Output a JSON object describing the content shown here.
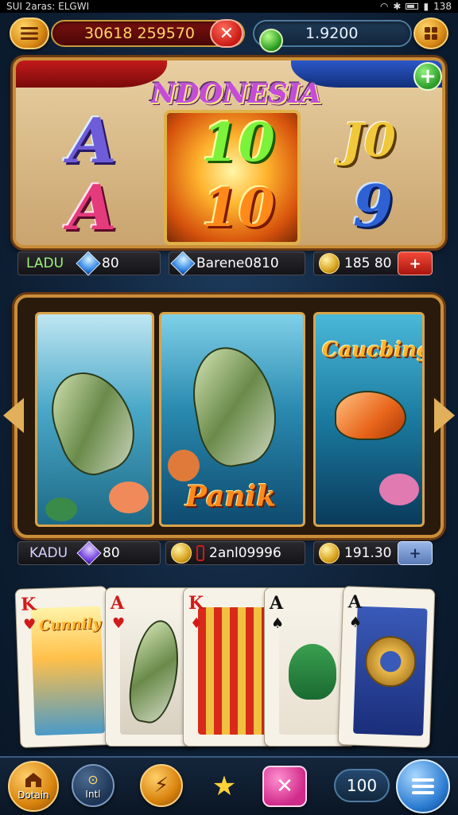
{
  "status_bar": {
    "left_text": "SUI 2aras: ELGWI",
    "right_text": "138"
  },
  "top_bar": {
    "balance_red": "30618 259570",
    "balance_blue": "1.9200"
  },
  "top_panel": {
    "title": "NDONESIA",
    "symbols": {
      "left_top": "A",
      "left_bottom": "A",
      "center_top": "10",
      "center_bottom": "10",
      "right_top": "J0",
      "right_bottom": "9"
    }
  },
  "stats_row_1": {
    "label": "LADU",
    "gem_value": "80",
    "name": "Barene0810",
    "coins": "185 80",
    "button": "+"
  },
  "middle_panel": {
    "word_center": "Panik",
    "word_right": "Caucbing"
  },
  "stats_row_2": {
    "label": "KADU",
    "gem_value": "80",
    "name": "2anl09996",
    "coins": "191.30",
    "button": "+"
  },
  "cards": [
    {
      "rank": "K",
      "suit": "♥",
      "color": "red",
      "art_text": "Cunnily"
    },
    {
      "rank": "A",
      "suit": "♥",
      "color": "red",
      "art_text": ""
    },
    {
      "rank": "K",
      "suit": "♦",
      "color": "red",
      "art_text": ""
    },
    {
      "rank": "A",
      "suit": "♠",
      "color": "black",
      "art_text": ""
    },
    {
      "rank": "A",
      "suit": "♠",
      "color": "black",
      "art_text": ""
    }
  ],
  "bottom_bar": {
    "home_label": "Dotain",
    "info_label": "Intl",
    "count": "100"
  },
  "colors": {
    "gold": "#c98e3a",
    "accent_red": "#c81a14",
    "accent_green": "#2e9e24",
    "bg": "#0f2238"
  },
  "icons": [
    "menu-icon",
    "close-icon",
    "green-gem-icon",
    "grid-icon",
    "plus-icon",
    "blue-gem-icon",
    "coin-icon",
    "purple-gem-icon",
    "home-icon",
    "info-icon",
    "lightning-icon",
    "star-icon",
    "x-icon",
    "list-icon"
  ]
}
